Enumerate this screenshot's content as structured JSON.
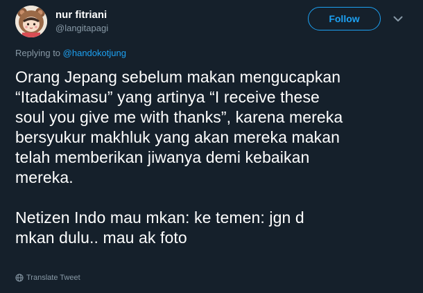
{
  "user": {
    "display_name": "nur fitriani",
    "handle": "@langitapagi"
  },
  "actions": {
    "follow_label": "Follow",
    "more_icon": "chevron-down-icon"
  },
  "reply": {
    "prefix": "Replying to ",
    "mention": "@handokotjung"
  },
  "tweet": {
    "paragraph_1": [
      "Orang Jepang sebelum makan mengucapkan",
      "“Itadakimasu” yang artinya “I receive these",
      "soul you give me with thanks”, karena mereka",
      "bersyukur makhluk yang akan mereka makan",
      "telah memberikan jiwanya demi kebaikan",
      "mereka."
    ],
    "paragraph_2": [
      "Netizen Indo mau mkan: ke temen: jgn d",
      "mkan dulu.. mau ak foto"
    ]
  },
  "footer": {
    "translate_label": "Translate Tweet",
    "translate_icon": "globe-icon"
  },
  "colors": {
    "background": "#15202b",
    "accent": "#1da1f2",
    "secondary_text": "#8899a6",
    "primary_text": "#ffffff"
  }
}
